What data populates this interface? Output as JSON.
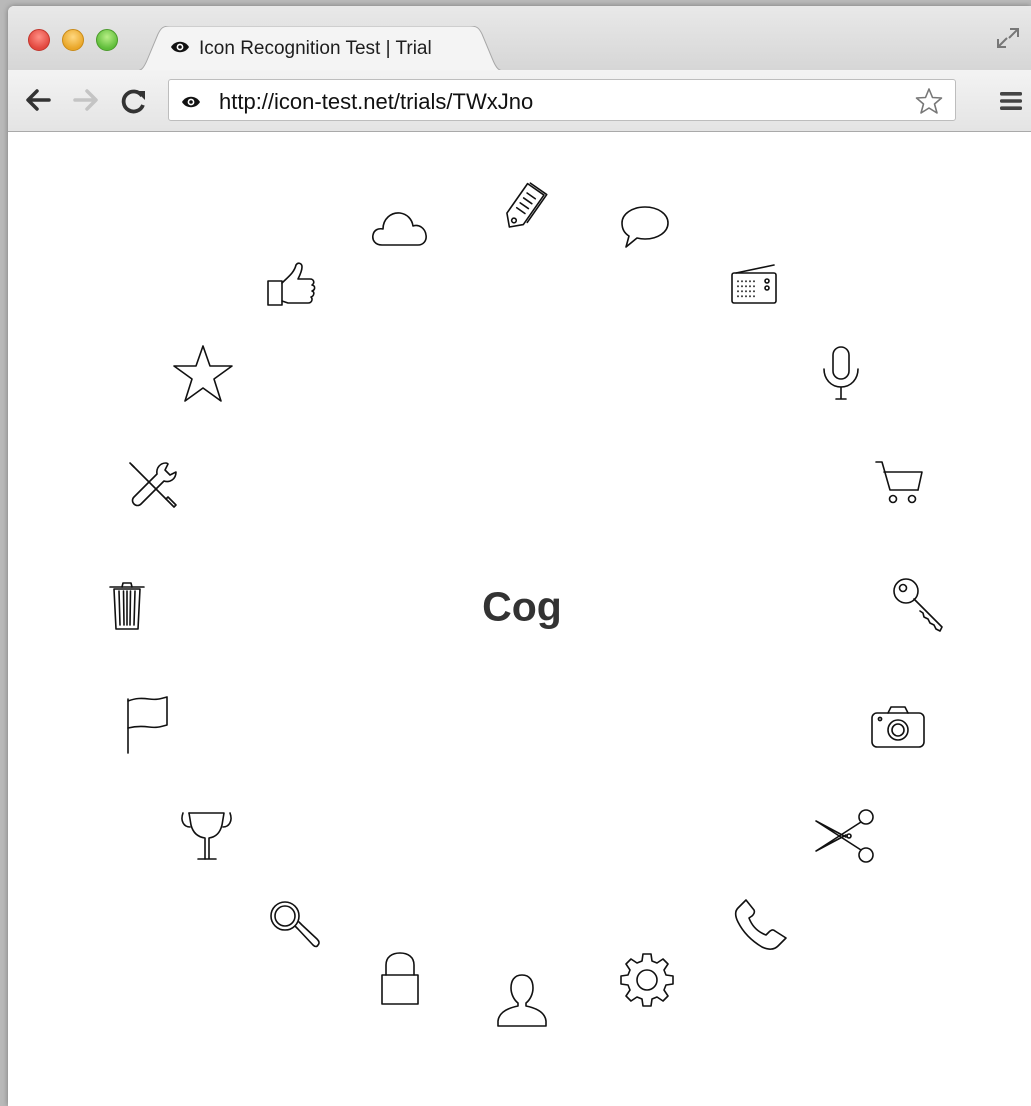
{
  "browser": {
    "tab_title": "Icon Recognition Test | Trial",
    "url": "http://icon-test.net/trials/TWxJno"
  },
  "trial": {
    "target_word": "Cog"
  },
  "icons": [
    "tag-icon",
    "speech-bubble-icon",
    "radio-icon",
    "microphone-icon",
    "cart-icon",
    "key-icon",
    "camera-icon",
    "scissors-icon",
    "phone-icon",
    "cog-icon",
    "user-icon",
    "lock-icon",
    "search-icon",
    "trophy-icon",
    "flag-icon",
    "trash-icon",
    "tools-icon",
    "star-icon",
    "thumbs-up-icon",
    "cloud-icon"
  ]
}
